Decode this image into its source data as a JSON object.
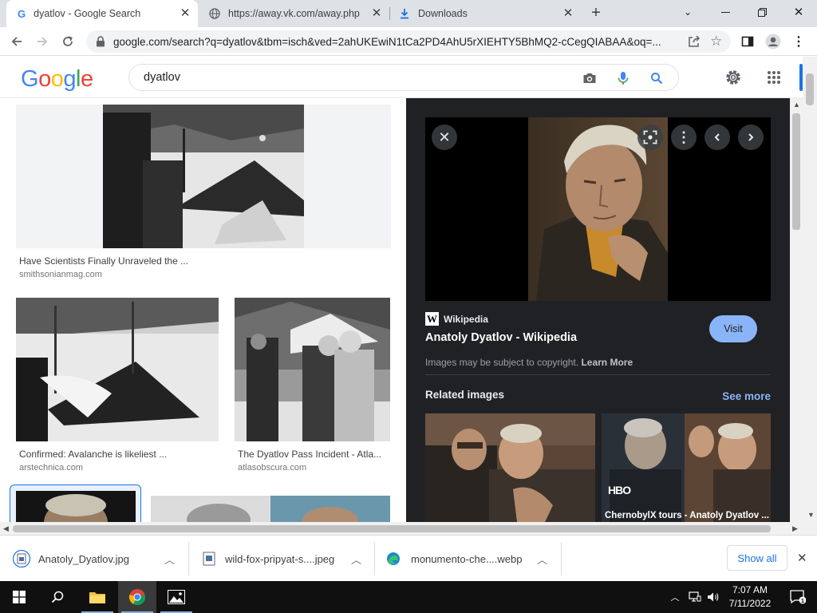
{
  "browser": {
    "tabs": [
      {
        "title": "dyatlov - Google Search",
        "active": true
      },
      {
        "title": "https://away.vk.com/away.php",
        "active": false
      },
      {
        "title": "Downloads",
        "active": false
      }
    ],
    "url": "google.com/search?q=dyatlov&tbm=isch&ved=2ahUKEwiN1tCa2PD4AhU5rXIEHTY5BhMQ2-cCegQIABAA&oq=..."
  },
  "google": {
    "logo_letters": [
      {
        "ch": "G",
        "color": "#4285f4"
      },
      {
        "ch": "o",
        "color": "#ea4335"
      },
      {
        "ch": "o",
        "color": "#fbbc05"
      },
      {
        "ch": "g",
        "color": "#4285f4"
      },
      {
        "ch": "l",
        "color": "#34a853"
      },
      {
        "ch": "e",
        "color": "#ea4335"
      }
    ],
    "query": "dyatlov"
  },
  "results": [
    {
      "title": "Have Scientists Finally Unraveled the ...",
      "source": "smithsonianmag.com"
    },
    {
      "title": "Confirmed: Avalanche is likeliest ...",
      "source": "arstechnica.com"
    },
    {
      "title": "The Dyatlov Pass Incident - Atla...",
      "source": "atlasobscura.com"
    }
  ],
  "panel": {
    "source": "Wikipedia",
    "source_badge": "W",
    "title": "Anatoly Dyatlov - Wikipedia",
    "visit_label": "Visit",
    "copyright": "Images may be subject to copyright.",
    "learn_more": "Learn More",
    "related_heading": "Related images",
    "see_more": "See more",
    "related": [
      {
        "title": ""
      },
      {
        "title": "ChernobylX tours - Anatoly Dyatlov ...",
        "logo": "HBO"
      }
    ]
  },
  "downloads": {
    "items": [
      {
        "name": "Anatoly_Dyatlov.jpg"
      },
      {
        "name": "wild-fox-pripyat-s....jpeg"
      },
      {
        "name": "monumento-che....webp"
      }
    ],
    "show_all": "Show all"
  },
  "taskbar": {
    "time": "7:07 AM",
    "date": "7/11/2022"
  },
  "colors": {
    "accent": "#1a73e8",
    "panel_bg": "#202124",
    "visit_bg": "#8ab4f8"
  }
}
